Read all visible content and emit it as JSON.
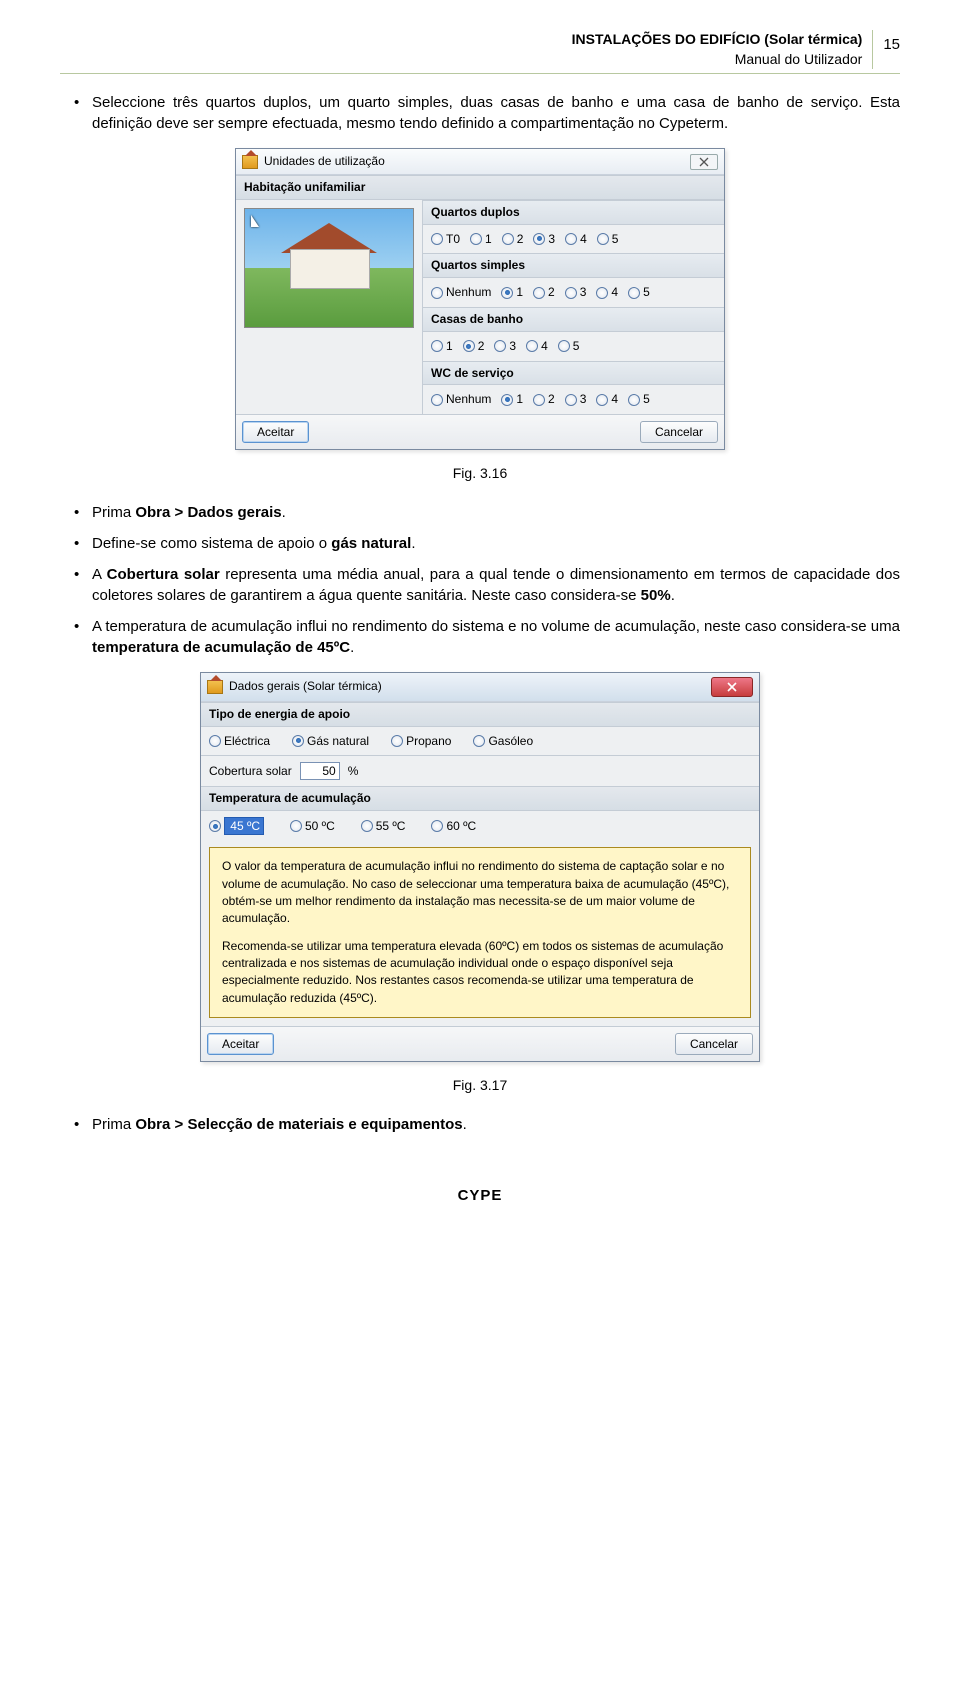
{
  "header": {
    "title_line1": "INSTALAÇÕES DO EDIFÍCIO (Solar térmica)",
    "title_line2": "Manual do Utilizador",
    "page_number": "15"
  },
  "bullets_top": {
    "b1a": "Seleccione três quartos duplos, um quarto simples, duas casas de banho e uma casa de banho de serviço. Esta definição deve ser sempre efectuada, mesmo tendo definido a compartimentação no Cypeterm."
  },
  "fig1": "Fig. 3.16",
  "dialog1": {
    "title": "Unidades de utilização",
    "section": "Habitação unifamiliar",
    "group1": "Quartos duplos",
    "g1_opts": [
      "T0",
      "1",
      "2",
      "3",
      "4",
      "5"
    ],
    "g1_sel": 3,
    "group2": "Quartos simples",
    "g2_opts": [
      "Nenhum",
      "1",
      "2",
      "3",
      "4",
      "5"
    ],
    "g2_sel": 1,
    "group3": "Casas de banho",
    "g3_opts": [
      "1",
      "2",
      "3",
      "4",
      "5"
    ],
    "g3_sel": 1,
    "group4": "WC de serviço",
    "g4_opts": [
      "Nenhum",
      "1",
      "2",
      "3",
      "4",
      "5"
    ],
    "g4_sel": 1,
    "accept": "Aceitar",
    "cancel": "Cancelar"
  },
  "bullets_mid": {
    "b2a": "Prima ",
    "b2b": "Obra > Dados gerais",
    "b2c": ".",
    "b3a": "Define-se como sistema de apoio o ",
    "b3b": "gás natural",
    "b3c": ".",
    "b4a": "A ",
    "b4b": "Cobertura solar",
    "b4c": " representa uma média anual, para a qual tende o dimensionamento em termos de capacidade dos coletores solares de garantirem a água quente sanitária. Neste caso considera-se ",
    "b4d": "50%",
    "b4e": ".",
    "b5a": "A temperatura de acumulação influi no rendimento do sistema e no volume de acumulação, neste caso considera-se uma ",
    "b5b": "temperatura de acumulação de 45ºC",
    "b5c": "."
  },
  "dialog2": {
    "title": "Dados gerais (Solar térmica)",
    "section1": "Tipo de energia de apoio",
    "energy_opts": [
      "Eléctrica",
      "Gás natural",
      "Propano",
      "Gasóleo"
    ],
    "energy_sel": 1,
    "cov_label": "Cobertura solar",
    "cov_value": "50",
    "cov_unit": "%",
    "section2": "Temperatura de acumulação",
    "temp_opts": [
      "45 ºC",
      "50 ºC",
      "55 ºC",
      "60 ºC"
    ],
    "temp_sel": 0,
    "info_p1": "O valor da temperatura de acumulação influi no rendimento do sistema de captação solar e no volume de acumulação. No caso de seleccionar uma temperatura baixa de acumulação (45ºC), obtém-se um melhor rendimento da instalação mas necessita-se de um maior volume de acumulação.",
    "info_p2": "Recomenda-se utilizar uma temperatura elevada (60ºC) em todos os sistemas de acumulação centralizada e nos sistemas de acumulação individual onde o espaço disponível seja especialmente reduzido. Nos restantes casos recomenda-se utilizar uma temperatura de acumulação reduzida (45ºC).",
    "accept": "Aceitar",
    "cancel": "Cancelar"
  },
  "fig2": "Fig. 3.17",
  "bullets_bot": {
    "b6a": "Prima ",
    "b6b": "Obra > Selecção de materiais e equipamentos",
    "b6c": "."
  },
  "footer": "CYPE"
}
